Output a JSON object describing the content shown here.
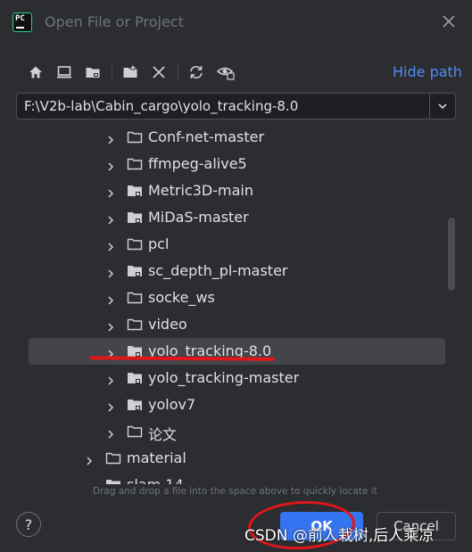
{
  "window": {
    "title": "Open File or Project",
    "app_icon_label": "PC"
  },
  "toolbar": {
    "icons": [
      "home-icon",
      "desktop-icon",
      "project-folder-icon",
      "new-folder-icon",
      "delete-icon",
      "refresh-icon",
      "show-hidden-icon"
    ],
    "hide_path_label": "Hide path"
  },
  "path": {
    "value": "F:\\V2b-lab\\Cabin_cargo\\yolo_tracking-8.0"
  },
  "tree": {
    "items": [
      {
        "label": "Conf-net-master",
        "depth": 1,
        "module": false,
        "selected": false
      },
      {
        "label": "ffmpeg-alive5",
        "depth": 1,
        "module": false,
        "selected": false
      },
      {
        "label": "Metric3D-main",
        "depth": 1,
        "module": true,
        "selected": false
      },
      {
        "label": "MiDaS-master",
        "depth": 1,
        "module": true,
        "selected": false
      },
      {
        "label": "pcl",
        "depth": 1,
        "module": false,
        "selected": false
      },
      {
        "label": "sc_depth_pl-master",
        "depth": 1,
        "module": true,
        "selected": false
      },
      {
        "label": "socke_ws",
        "depth": 1,
        "module": false,
        "selected": false
      },
      {
        "label": "video",
        "depth": 1,
        "module": false,
        "selected": false
      },
      {
        "label": "yolo_tracking-8.0",
        "depth": 1,
        "module": true,
        "selected": true
      },
      {
        "label": "yolo_tracking-master",
        "depth": 1,
        "module": true,
        "selected": false
      },
      {
        "label": "yolov7",
        "depth": 1,
        "module": true,
        "selected": false
      },
      {
        "label": "论文",
        "depth": 1,
        "module": false,
        "selected": false
      },
      {
        "label": "material",
        "depth": 0,
        "module": false,
        "selected": false
      },
      {
        "label": "slam 14",
        "depth": 0,
        "module": true,
        "selected": false
      }
    ]
  },
  "footer": {
    "hint": "Drag and drop a file into the space above to quickly locate it",
    "help_label": "?",
    "ok_label": "OK",
    "cancel_label": "Cancel"
  },
  "watermark": "CSDN @前人栽树,后人乘凉",
  "colors": {
    "background": "#2b2d30",
    "accent": "#3574f0",
    "link": "#548af7",
    "selection": "#43454a",
    "annotation": "#e0161b"
  }
}
